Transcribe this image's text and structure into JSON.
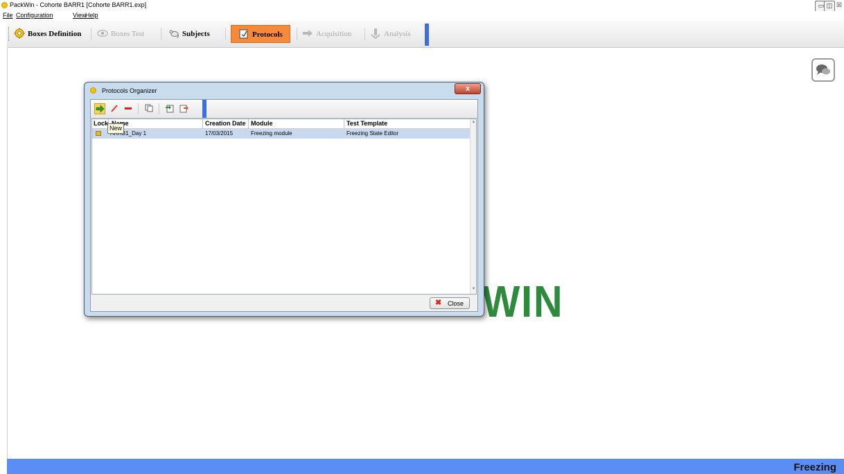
{
  "window": {
    "title": "PackWin - Cohorte BARR1 [Cohorte BARR1.exp]",
    "controls": {
      "minimize": "▭",
      "maximize": "◫",
      "close": "☒"
    }
  },
  "menu": [
    "File",
    "Configuration",
    "View",
    "Help"
  ],
  "toolbar": {
    "items": [
      {
        "label": "Boxes Definition",
        "icon": "gear-icon",
        "enabled": true
      },
      {
        "label": "Boxes Test",
        "icon": "eye-icon",
        "enabled": false
      },
      {
        "label": "Subjects",
        "icon": "mouse-icon",
        "enabled": true
      },
      {
        "label": "Protocols",
        "icon": "protocol-icon",
        "enabled": true,
        "active": true
      },
      {
        "label": "Acquisition",
        "icon": "arrow-icon",
        "enabled": false
      },
      {
        "label": "Analysis",
        "icon": "analysis-icon",
        "enabled": false
      }
    ]
  },
  "background_logo": "WIN",
  "status": {
    "module": "Freezing"
  },
  "dialog": {
    "title": "Protocols Organizer",
    "close_glyph": "x",
    "tooltip": "New",
    "columns": [
      "Lock",
      "Name",
      "Creation Date",
      "Module",
      "Test Template"
    ],
    "rows": [
      {
        "lock": "locked",
        "name": "ARRB1_Day 1",
        "creation_date": "17/03/2015",
        "module": "Freezing module",
        "test_template": "Freezing State Editor"
      }
    ],
    "close_button": "Close"
  }
}
